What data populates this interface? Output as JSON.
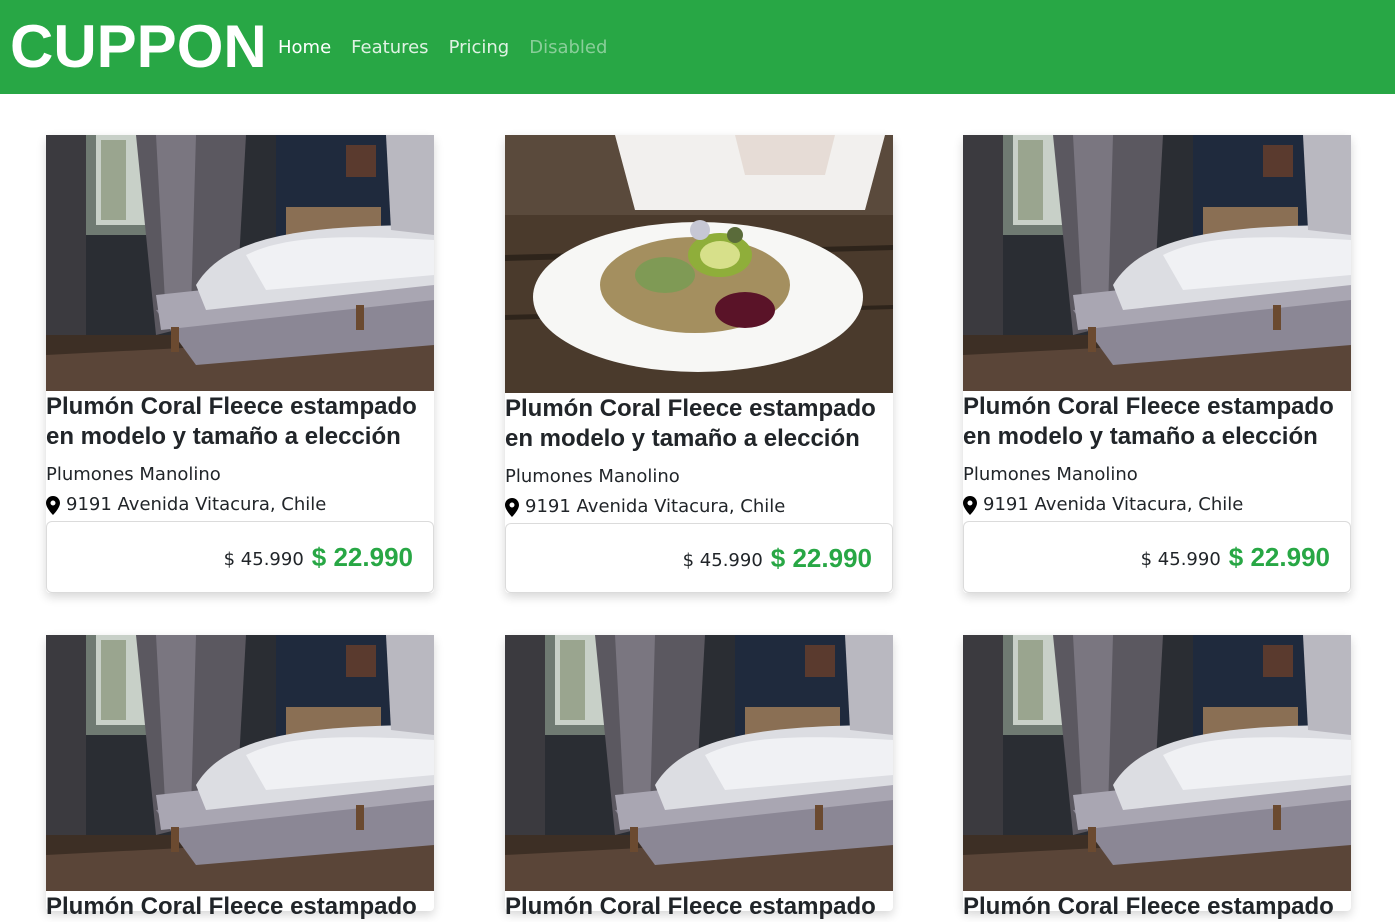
{
  "navbar": {
    "brand": "CUPPON",
    "links": [
      {
        "label": "Home",
        "state": "active"
      },
      {
        "label": "Features",
        "state": "normal"
      },
      {
        "label": "Pricing",
        "state": "normal"
      },
      {
        "label": "Disabled",
        "state": "disabled"
      }
    ]
  },
  "colors": {
    "accent": "#28a745",
    "text": "#212529"
  },
  "cards": [
    {
      "image": "bedroom-photo",
      "title": "Plumón Coral Fleece estampado en modelo y tamaño a elección",
      "seller": "Plumones Manolino",
      "location": "9191 Avenida Vitacura, Chile",
      "old_price": "$ 45.990",
      "new_price": "$ 22.990"
    },
    {
      "image": "food-bowl-photo",
      "title": "Plumón Coral Fleece estampado en modelo y tamaño a elección",
      "seller": "Plumones Manolino",
      "location": "9191 Avenida Vitacura, Chile",
      "old_price": "$ 45.990",
      "new_price": "$ 22.990"
    },
    {
      "image": "bedroom-photo",
      "title": "Plumón Coral Fleece estampado en modelo y tamaño a elección",
      "seller": "Plumones Manolino",
      "location": "9191 Avenida Vitacura, Chile",
      "old_price": "$ 45.990",
      "new_price": "$ 22.990"
    },
    {
      "image": "bedroom-photo",
      "title": "Plumón Coral Fleece estampado",
      "seller": "",
      "location": "",
      "old_price": "",
      "new_price": ""
    },
    {
      "image": "bedroom-photo",
      "title": "Plumón Coral Fleece estampado",
      "seller": "",
      "location": "",
      "old_price": "",
      "new_price": ""
    },
    {
      "image": "bedroom-photo",
      "title": "Plumón Coral Fleece estampado",
      "seller": "",
      "location": "",
      "old_price": "",
      "new_price": ""
    }
  ]
}
